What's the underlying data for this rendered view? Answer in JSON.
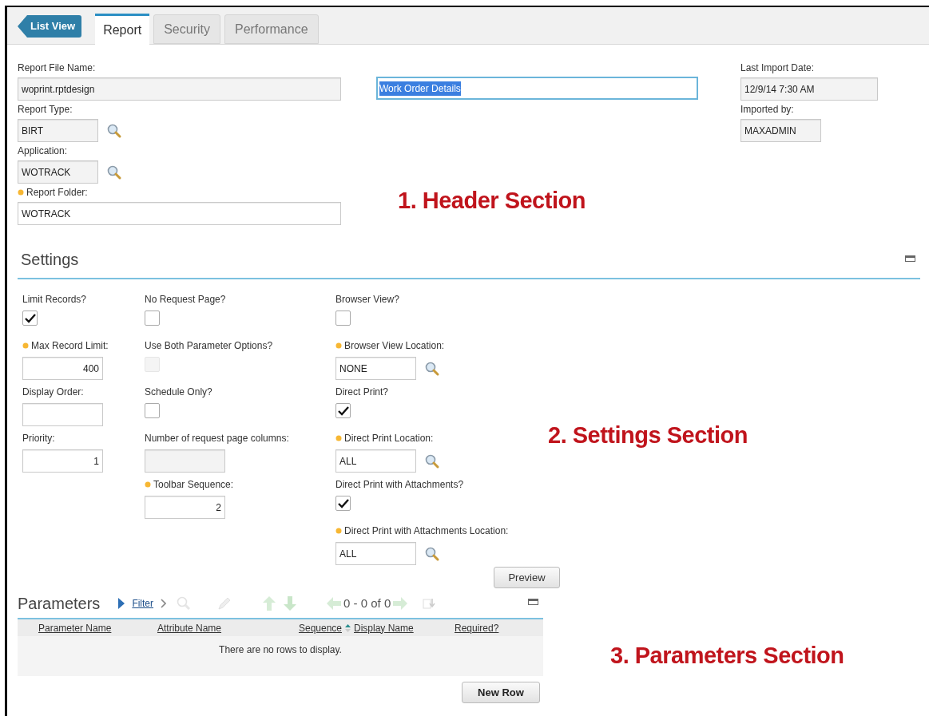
{
  "back_button": "List View",
  "tabs": [
    {
      "label": "Report",
      "selected": true
    },
    {
      "label": "Security",
      "selected": false
    },
    {
      "label": "Performance",
      "selected": false
    }
  ],
  "header": {
    "left_fields": [
      {
        "label": "Report File Name:",
        "value": "woprint.rptdesign",
        "required": false,
        "lookup": false,
        "read_only": true
      },
      {
        "label": "Report Type:",
        "value": "BIRT",
        "required": false,
        "lookup": true,
        "read_only": true
      },
      {
        "label": "Application:",
        "value": "WOTRACK",
        "required": false,
        "lookup": true,
        "read_only": true
      },
      {
        "label": "Report Folder:",
        "value": "WOTRACK",
        "required": true,
        "lookup": false,
        "read_only": false
      }
    ],
    "description": {
      "value": "Work Order Details",
      "text_selected": true
    },
    "right_fields": [
      {
        "label": "Last Import Date:",
        "value": "12/9/14 7:30 AM",
        "read_only": true
      },
      {
        "label": "Imported by:",
        "value": "MAXADMIN",
        "read_only": true
      }
    ]
  },
  "settings": {
    "title": "Settings",
    "columns": [
      [
        {
          "kind": "checkbox",
          "label": "Limit Records?",
          "checked": true,
          "disabled": false
        },
        {
          "kind": "number",
          "label": "Max Record Limit:",
          "value": "400",
          "required": true,
          "disabled": false
        },
        {
          "kind": "number",
          "label": "Display Order:",
          "required": false,
          "disabled": false
        },
        {
          "kind": "number",
          "label": "Priority:",
          "value": "1",
          "required": false,
          "disabled": false
        }
      ],
      [
        {
          "kind": "checkbox",
          "label": "No Request Page?",
          "checked": false,
          "disabled": false
        },
        {
          "kind": "checkbox",
          "label": "Use Both Parameter Options?",
          "checked": false,
          "disabled": true
        },
        {
          "kind": "checkbox",
          "label": "Schedule Only?",
          "checked": false,
          "disabled": false
        },
        {
          "kind": "number",
          "label": "Number of request page columns:",
          "required": false,
          "disabled": true
        },
        {
          "kind": "number",
          "label": "Toolbar Sequence:",
          "value": "2",
          "required": true,
          "disabled": false
        }
      ],
      [
        {
          "kind": "checkbox",
          "label": "Browser View?",
          "checked": false,
          "disabled": false
        },
        {
          "kind": "lookup",
          "label": "Browser View Location:",
          "value": "NONE",
          "required": true,
          "disabled": false
        },
        {
          "kind": "checkbox",
          "label": "Direct Print?",
          "checked": true,
          "disabled": false
        },
        {
          "kind": "lookup",
          "label": "Direct Print Location:",
          "value": "ALL",
          "required": true,
          "disabled": false
        },
        {
          "kind": "checkbox",
          "label": "Direct Print with Attachments?",
          "checked": true,
          "disabled": false
        },
        {
          "kind": "lookup",
          "label": "Direct Print with Attachments Location:",
          "value": "ALL",
          "required": true,
          "disabled": false
        }
      ]
    ],
    "preview_button": "Preview"
  },
  "parameters": {
    "title": "Parameters",
    "filter_link": "Filter",
    "pager": "0 - 0 of 0",
    "columns": [
      {
        "label": "Parameter Name",
        "sorted": false
      },
      {
        "label": "Attribute Name",
        "sorted": false
      },
      {
        "label": "Sequence",
        "sorted": true
      },
      {
        "label": "Display Name",
        "sorted": false
      },
      {
        "label": "Required?",
        "sorted": false
      }
    ],
    "empty_message": "There are no rows to display.",
    "new_row_button": "New Row"
  },
  "annotations": [
    "1. Header Section",
    "2. Settings Section",
    "3. Parameters Section"
  ]
}
